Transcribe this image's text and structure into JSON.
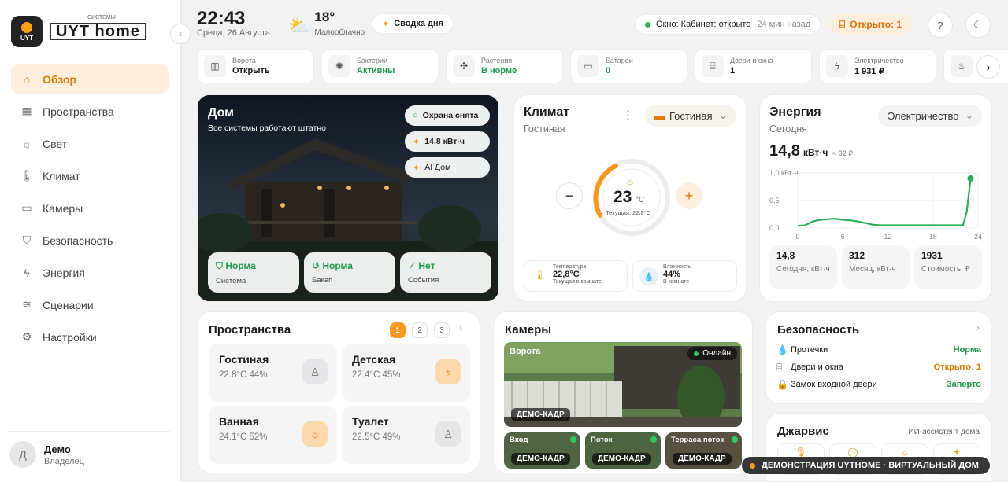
{
  "brand": {
    "badge_text": "UYT",
    "name": "UYT home",
    "tagline": "СИСТЕМЫ"
  },
  "nav": [
    {
      "label": "Обзор",
      "icon": "home-icon",
      "active": true
    },
    {
      "label": "Пространства",
      "icon": "grid-icon"
    },
    {
      "label": "Свет",
      "icon": "sun-icon"
    },
    {
      "label": "Климат",
      "icon": "thermometer-icon"
    },
    {
      "label": "Камеры",
      "icon": "camera-icon"
    },
    {
      "label": "Безопасность",
      "icon": "shield-icon"
    },
    {
      "label": "Энергия",
      "icon": "bolt-icon"
    },
    {
      "label": "Сценарии",
      "icon": "layers-icon"
    },
    {
      "label": "Настройки",
      "icon": "gear-icon"
    }
  ],
  "user": {
    "initial": "Д",
    "name": "Демо",
    "role": "Владелец"
  },
  "header": {
    "time": "22:43",
    "date": "Среда, 26 Августа",
    "temp": "18°",
    "weather": "Малооблачно",
    "day_summary": "Сводка дня",
    "status": "Окно: Кабинет: открыто",
    "status_ago": "24 мин назад",
    "open_count": "Открыто: 1"
  },
  "tiles": [
    {
      "label": "Ворота",
      "value": "Открыть",
      "icon": "gate-icon",
      "green": false
    },
    {
      "label": "Бактерии",
      "value": "Активны",
      "icon": "bacteria-icon",
      "green": true
    },
    {
      "label": "Растения",
      "value": "В норме",
      "icon": "plant-icon",
      "green": true
    },
    {
      "label": "Батареи",
      "value": "0",
      "icon": "battery-icon",
      "green": true
    },
    {
      "label": "Двери и окна",
      "value": "1",
      "icon": "door-icon",
      "green": false
    },
    {
      "label": "Электричество",
      "value": "1 931 ₽",
      "icon": "bolt-icon",
      "green": false
    }
  ],
  "home": {
    "title": "Дом",
    "subtitle": "Все системы работают штатно",
    "chips": [
      "Охрана снята",
      "14,8 кВт·ч",
      "AI Дом"
    ],
    "stats": [
      {
        "value": "Норма",
        "label": "Система"
      },
      {
        "value": "Норма",
        "label": "Бакап"
      },
      {
        "value": "Нет",
        "label": "События"
      }
    ]
  },
  "climate": {
    "title": "Климат",
    "room": "Гостиная",
    "room_select": "Гостиная",
    "target": "23",
    "unit": "°C",
    "current": "Текущая: 22,8°C",
    "temp_label": "Температура",
    "temp_value": "22,8°C",
    "temp_sub": "Текущая в комнате",
    "hum_label": "Влажность",
    "hum_value": "44%",
    "hum_sub": "В комнате"
  },
  "energy": {
    "title": "Энергия",
    "period": "Сегодня",
    "select": "Электричество",
    "value": "14,8",
    "unit": "кВт·ч",
    "cost": "≈ 92 ₽",
    "stats": [
      {
        "value": "14,8",
        "label": "Сегодня, кВт·ч"
      },
      {
        "value": "312",
        "label": "Месяц, кВт·ч"
      },
      {
        "value": "1931",
        "label": "Стоимость, ₽"
      }
    ]
  },
  "chart_data": {
    "type": "line",
    "ylabel": "",
    "y_unit": "кВт·ч",
    "y_ticks": [
      "1,0 кВт·ч",
      "0,5",
      "0,0"
    ],
    "x_ticks": [
      "0",
      "6",
      "12",
      "18",
      "24"
    ],
    "ylim": [
      0,
      1
    ],
    "xlim": [
      0,
      24
    ],
    "grid": true,
    "series": [
      {
        "x": [
          0,
          1,
          2,
          3,
          4,
          5,
          6,
          7,
          8,
          9,
          10,
          11,
          12,
          13,
          14,
          15,
          16,
          17,
          18,
          19,
          20,
          21,
          22,
          22.5,
          23
        ],
        "y": [
          0.04,
          0.05,
          0.12,
          0.15,
          0.16,
          0.17,
          0.15,
          0.14,
          0.12,
          0.09,
          0.06,
          0.05,
          0.05,
          0.05,
          0.05,
          0.05,
          0.05,
          0.05,
          0.05,
          0.05,
          0.05,
          0.05,
          0.05,
          0.3,
          0.9
        ]
      }
    ]
  },
  "spaces": {
    "title": "Пространства",
    "pages": [
      "1",
      "2",
      "3"
    ],
    "items": [
      {
        "name": "Гостиная",
        "stats": "22.8°C 44%",
        "on": false
      },
      {
        "name": "Детская",
        "stats": "22.4°C 45%",
        "on": true
      },
      {
        "name": "Ванная",
        "stats": "24.1°C 52%",
        "on": true
      },
      {
        "name": "Туалет",
        "stats": "22.5°C 49%",
        "on": false
      }
    ]
  },
  "cameras": {
    "title": "Камеры",
    "main": {
      "name": "Ворота",
      "status": "Онлайн",
      "tag": "ДЕМО-КАДР"
    },
    "small": [
      {
        "name": "Вход",
        "tag": "ДЕМО-КАДР"
      },
      {
        "name": "Поток",
        "tag": "ДЕМО-КАДР"
      },
      {
        "name": "Терраса поток",
        "tag": "ДЕМО-КАДР"
      }
    ]
  },
  "security": {
    "title": "Безопасность",
    "rows": [
      {
        "label": "Протечки",
        "value": "Норма",
        "color": "#1d9b49",
        "icon": "drop-icon"
      },
      {
        "label": "Двери и окна",
        "value": "Открыто: 1",
        "color": "#e07b00",
        "icon": "door-icon"
      },
      {
        "label": "Замок входной двери",
        "value": "Заперто",
        "color": "#1d9b49",
        "icon": "lock-icon"
      }
    ]
  },
  "jarvis": {
    "title": "Джарвис",
    "subtitle": "ИИ-ассистент дома"
  },
  "banner": "ДЕМОНСТРАЦИЯ UYTHOME · ВИРТУАЛЬНЫЙ ДОМ"
}
